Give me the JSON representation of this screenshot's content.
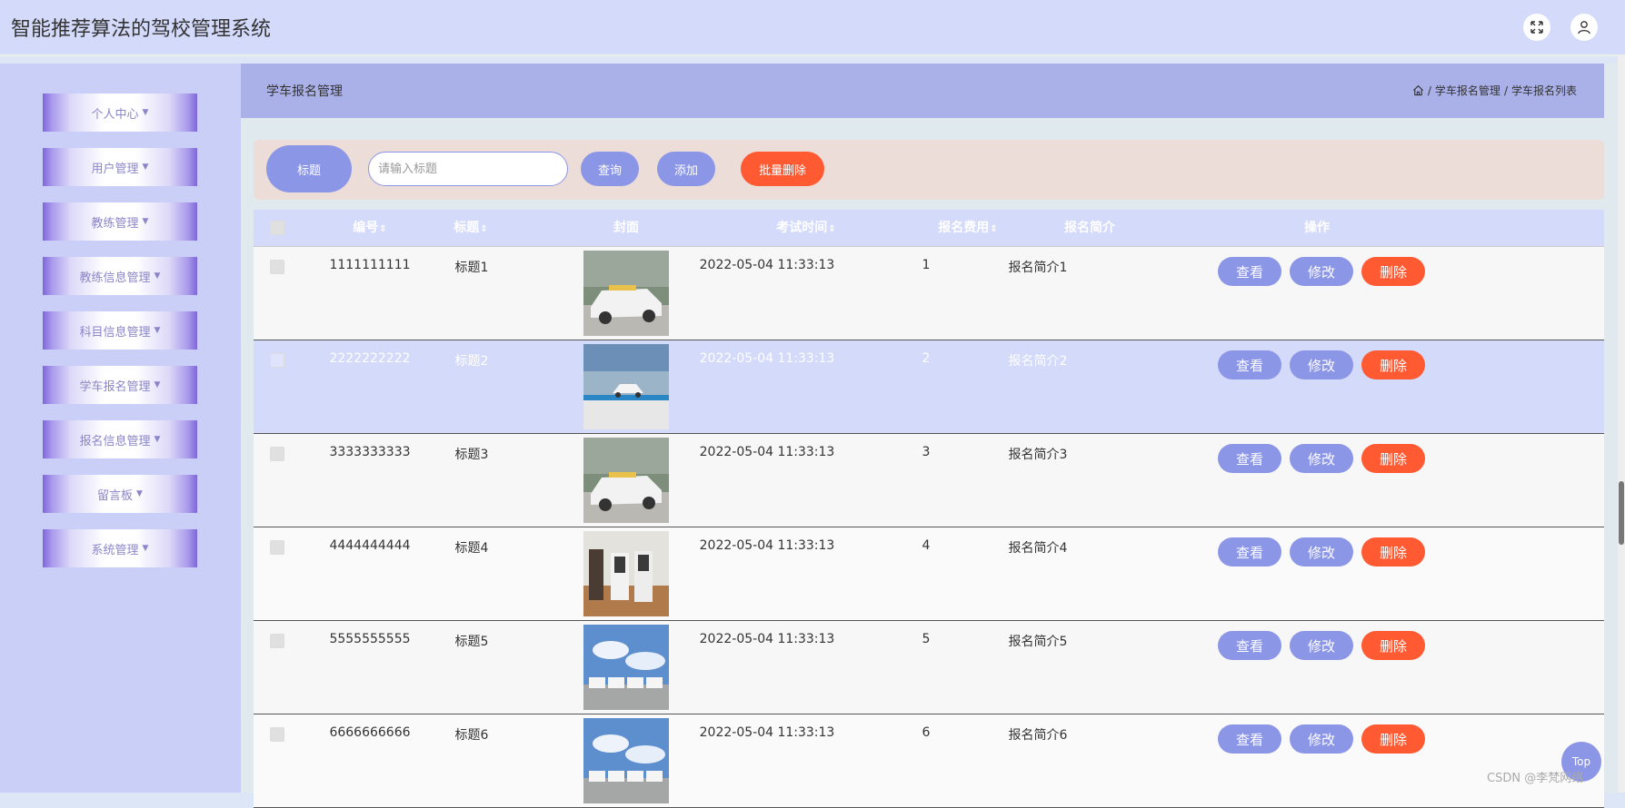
{
  "header": {
    "title": "智能推荐算法的驾校管理系统"
  },
  "sidebar": {
    "items": [
      {
        "label": "个人中心"
      },
      {
        "label": "用户管理"
      },
      {
        "label": "教练管理"
      },
      {
        "label": "教练信息管理"
      },
      {
        "label": "科目信息管理"
      },
      {
        "label": "学车报名管理"
      },
      {
        "label": "报名信息管理"
      },
      {
        "label": "留言板"
      },
      {
        "label": "系统管理"
      }
    ]
  },
  "page": {
    "title": "学车报名管理",
    "breadcrumb": [
      "学车报名管理",
      "学车报名列表"
    ],
    "breadcrumb_sep": "/"
  },
  "search": {
    "label": "标题",
    "placeholder": "请输入标题",
    "value": "",
    "query_label": "查询",
    "add_label": "添加",
    "batch_delete_label": "批量删除"
  },
  "table": {
    "columns": [
      "编号",
      "标题",
      "封面",
      "考试时间",
      "报名费用",
      "报名简介",
      "操作"
    ],
    "sort_glyph": "⇕",
    "actions": {
      "view": "查看",
      "edit": "修改",
      "delete": "删除"
    },
    "rows": [
      {
        "id": "1111111111",
        "title": "标题1",
        "cover": "car-photo",
        "time": "2022-05-04 11:33:13",
        "fee": "1",
        "intro": "报名简介1"
      },
      {
        "id": "2222222222",
        "title": "标题2",
        "cover": "car-lot-photo",
        "time": "2022-05-04 11:33:13",
        "fee": "2",
        "intro": "报名简介2"
      },
      {
        "id": "3333333333",
        "title": "标题3",
        "cover": "car-photo",
        "time": "2022-05-04 11:33:13",
        "fee": "3",
        "intro": "报名简介3"
      },
      {
        "id": "4444444444",
        "title": "标题4",
        "cover": "simulator-photo",
        "time": "2022-05-04 11:33:13",
        "fee": "4",
        "intro": "报名简介4"
      },
      {
        "id": "5555555555",
        "title": "标题5",
        "cover": "cars-sky-photo",
        "time": "2022-05-04 11:33:13",
        "fee": "5",
        "intro": "报名简介5"
      },
      {
        "id": "6666666666",
        "title": "标题6",
        "cover": "cars-sky-photo",
        "time": "2022-05-04 11:33:13",
        "fee": "6",
        "intro": "报名简介6"
      }
    ]
  },
  "footer": {
    "top_label": "Top",
    "watermark": "CSDN @李梵网络"
  },
  "colors": {
    "accent": "#8c96e6",
    "danger": "#ff5a32",
    "header_bg": "#d4dafa",
    "highlight_row": "#d4dafa"
  },
  "icons": [
    "fullscreen-icon",
    "user-icon",
    "home-icon",
    "chevron-down-icon"
  ]
}
